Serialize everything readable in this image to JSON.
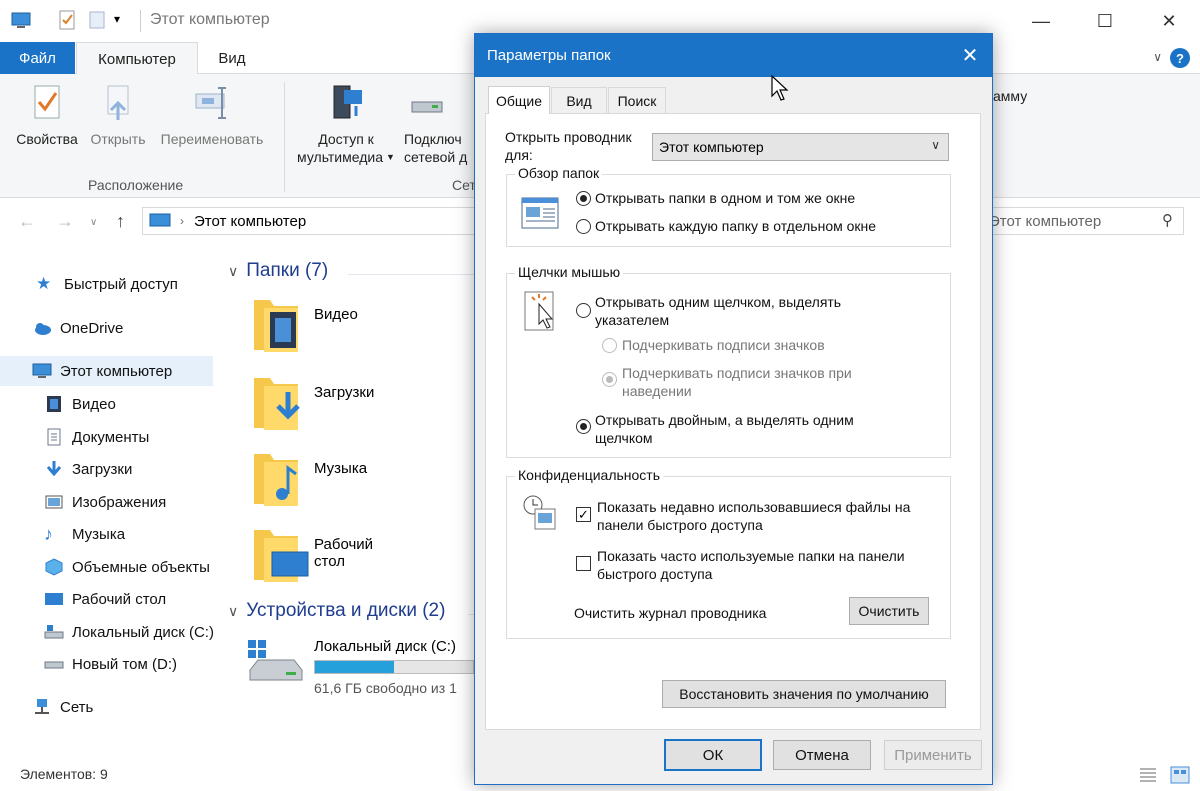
{
  "window": {
    "title": "Этот компьютер",
    "controls": {
      "minimize": "—",
      "maximize": "☐",
      "close": "✕"
    }
  },
  "ribbon": {
    "tabs": [
      "Файл",
      "Компьютер",
      "Вид"
    ],
    "help": "?",
    "buttons": {
      "properties": "Свойства",
      "open": "Открыть",
      "rename": "Переименовать",
      "media_line1": "Доступ к",
      "media_line2": "мультимедиа",
      "map_line1": "Подключ",
      "map_line2": "сетевой д",
      "program_suffix": "амму"
    },
    "groups": {
      "location": "Расположение",
      "network": "Сет"
    }
  },
  "address": {
    "path": "Этот компьютер",
    "search_placeholder": "Этот компьютер"
  },
  "nav": {
    "items": [
      {
        "label": "Быстрый доступ",
        "icon": "star-icon"
      },
      {
        "label": "OneDrive",
        "icon": "cloud-icon"
      },
      {
        "label": "Этот компьютер",
        "icon": "computer-icon"
      },
      {
        "label": "Видео",
        "icon": "video-icon"
      },
      {
        "label": "Документы",
        "icon": "documents-icon"
      },
      {
        "label": "Загрузки",
        "icon": "download-icon"
      },
      {
        "label": "Изображения",
        "icon": "pictures-icon"
      },
      {
        "label": "Музыка",
        "icon": "music-icon"
      },
      {
        "label": "Объемные объекты",
        "icon": "3d-objects-icon"
      },
      {
        "label": "Рабочий стол",
        "icon": "desktop-icon"
      },
      {
        "label": "Локальный диск (C:)",
        "icon": "drive-icon"
      },
      {
        "label": "Новый том (D:)",
        "icon": "drive-icon"
      },
      {
        "label": "Сеть",
        "icon": "network-icon"
      }
    ]
  },
  "content": {
    "folders_header": "Папки (7)",
    "folders": [
      "Видео",
      "Загрузки",
      "Музыка",
      "Рабочий стол"
    ],
    "devices_header": "Устройства и диски (2)",
    "drive": {
      "name": "Локальный диск (C:)",
      "free": "61,6 ГБ свободно из 1",
      "used_fraction": 0.5
    }
  },
  "status": {
    "items_count": "Элементов: 9"
  },
  "dialog": {
    "title": "Параметры папок",
    "tabs": [
      "Общие",
      "Вид",
      "Поиск"
    ],
    "open_explorer_label_1": "Открыть проводник",
    "open_explorer_label_2": "для:",
    "open_explorer_value": "Этот компьютер",
    "browse_group": "Обзор папок",
    "browse_same": "Открывать папки в одном и том же окне",
    "browse_new": "Открывать каждую папку в отдельном окне",
    "click_group": "Щелчки мышью",
    "single_click_1": "Открывать одним щелчком, выделять",
    "single_click_2": "указателем",
    "underline_always": "Подчеркивать подписи значков",
    "underline_hover_1": "Подчеркивать подписи значков при",
    "underline_hover_2": "наведении",
    "double_click_1": "Открывать двойным, а выделять одним",
    "double_click_2": "щелчком",
    "privacy_group": "Конфиденциальность",
    "recent_files_1": "Показать недавно использовавшиеся файлы на",
    "recent_files_2": "панели быстрого доступа",
    "frequent_folders_1": "Показать часто используемые папки на панели",
    "frequent_folders_2": "быстрого доступа",
    "clear_history_label": "Очистить журнал проводника",
    "clear_button": "Очистить",
    "restore_defaults": "Восстановить значения по умолчанию",
    "ok": "ОК",
    "cancel": "Отмена",
    "apply": "Применить"
  }
}
